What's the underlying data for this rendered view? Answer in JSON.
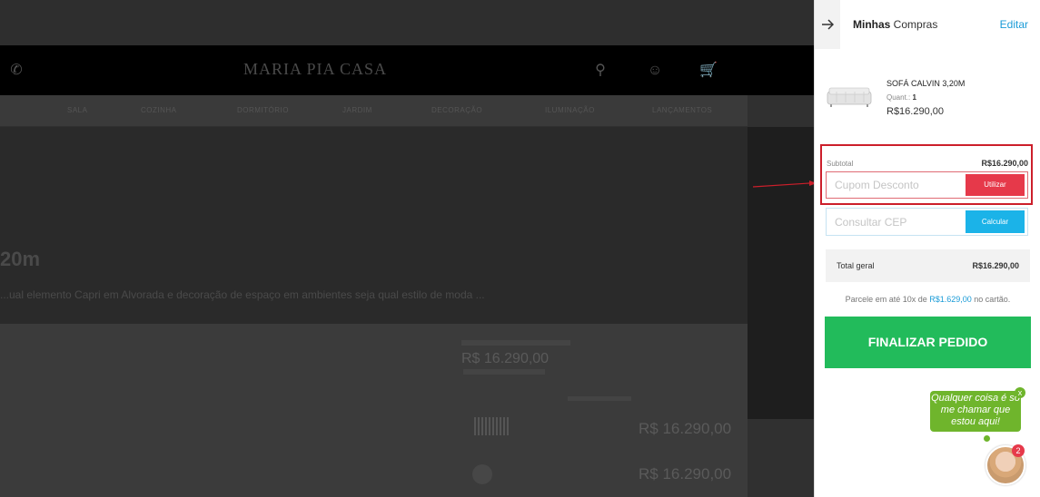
{
  "background": {
    "logo": "MARIA PIA CASA",
    "nav_items": [
      "",
      "SALA",
      "COZINHA",
      "DORMITÓRIO",
      "JARDIM",
      "DECORAÇÃO",
      "ILUMINAÇÃO",
      "LANÇAMENTOS"
    ],
    "product_title": "20m",
    "description": "...ual elemento Capri em Alvorada e decoração de espaço em ambientes seja qual estilo de moda ...",
    "prices": [
      "R$ 16.290,00",
      "R$ 16.290,00",
      "R$ 16.290,00"
    ]
  },
  "cart": {
    "title_bold": "Minhas",
    "title_rest": " Compras",
    "edit_label": "Editar",
    "item": {
      "name": "SOFÁ CALVIN 3,20M",
      "qty_label": "Quant.:",
      "qty_value": "1",
      "price": "R$16.290,00"
    },
    "subtotal_label": "Subtotal",
    "subtotal_value": "R$16.290,00",
    "coupon_placeholder": "Cupom Desconto",
    "coupon_button": "Utilizar",
    "cep_placeholder": "Consultar CEP",
    "cep_button": "Calcular",
    "total_label": "Total geral",
    "total_value": "R$16.290,00",
    "installments_prefix": "Parcele em até 10x de ",
    "installments_amount": "R$1.629,00",
    "installments_suffix": " no cartão.",
    "checkout_button": "FINALIZAR PEDIDO"
  },
  "chat": {
    "message": "Qualquer coisa é só me chamar que estou aqui!",
    "close": "x",
    "badge": "2"
  },
  "colors": {
    "accent_blue": "#1a9bd7",
    "coupon_red": "#e6394a",
    "checkout_green": "#22bb5b",
    "chat_green": "#6fb52c",
    "highlight_red": "#cc1f2b"
  }
}
